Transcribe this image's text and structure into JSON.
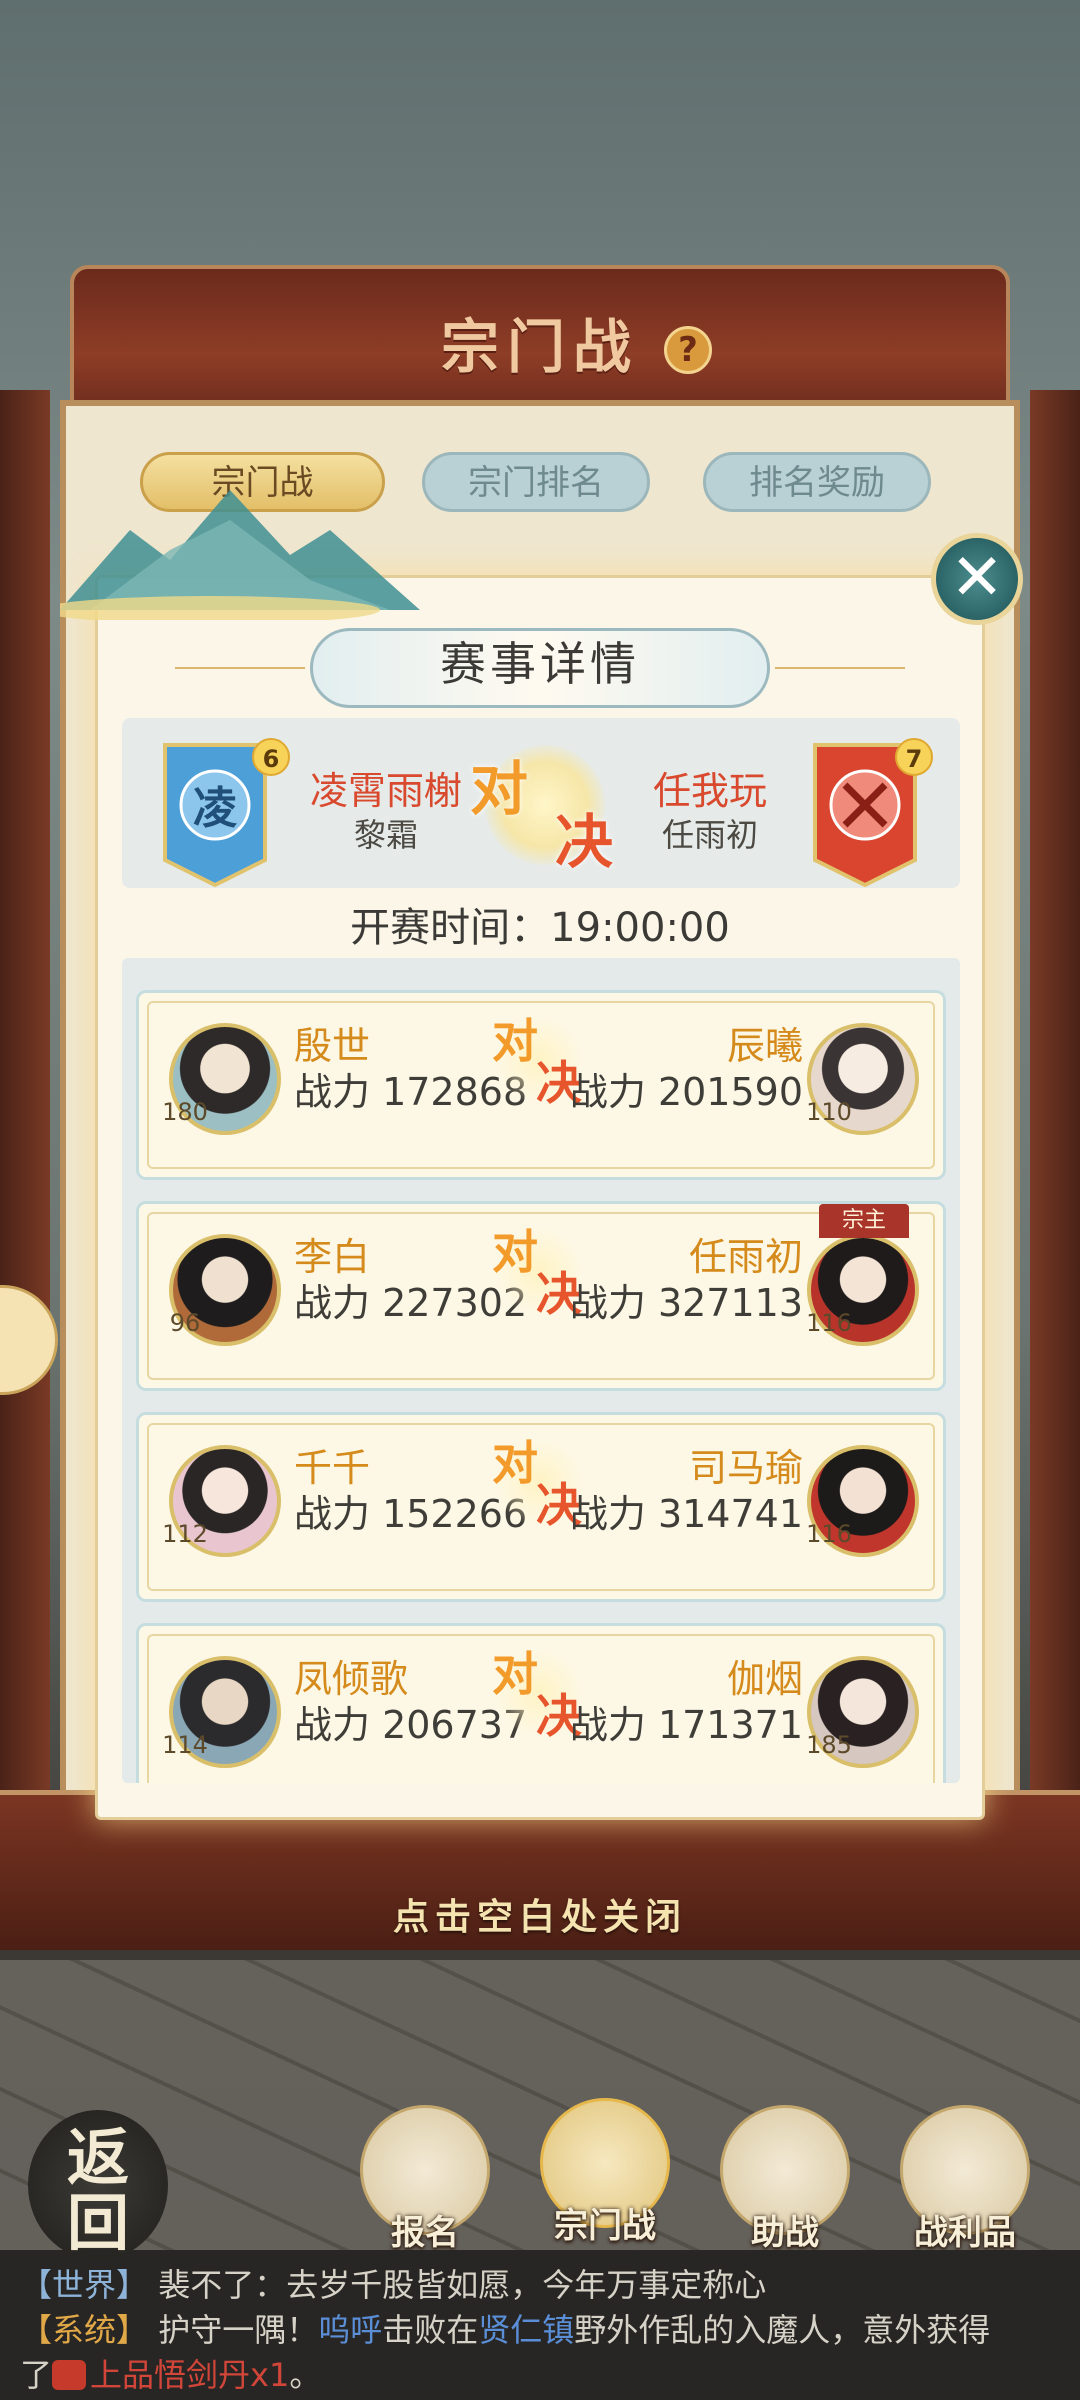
{
  "window": {
    "title": "宗门战"
  },
  "tabs": [
    {
      "label": "宗门战",
      "active": true
    },
    {
      "label": "宗门排名",
      "active": false
    },
    {
      "label": "排名奖励",
      "active": false
    }
  ],
  "dialog": {
    "title": "赛事详情",
    "close_icon": "close-icon",
    "match": {
      "left": {
        "badge": "6",
        "banner_char": "凌",
        "sect": "凌霄雨榭",
        "leader": "黎霜",
        "color": "#4d9fd8"
      },
      "right": {
        "badge": "7",
        "sect": "任我玩",
        "leader": "任雨初",
        "color": "#d9452e"
      },
      "vs_top": "对",
      "vs_bottom": "决"
    },
    "start_time_label": "开赛时间：19:00:00",
    "duels": [
      {
        "left_name": "殷世",
        "left_power": "战力 172868",
        "left_level": "180",
        "right_name": "辰曦",
        "right_power": "战力 201590",
        "right_level": "110",
        "right_tag": ""
      },
      {
        "left_name": "李白",
        "left_power": "战力 227302",
        "left_level": "96",
        "right_name": "任雨初",
        "right_power": "战力 327113",
        "right_level": "116",
        "right_tag": "宗主"
      },
      {
        "left_name": "千千",
        "left_power": "战力 152266",
        "left_level": "112",
        "right_name": "司马瑜",
        "right_power": "战力 314741",
        "right_level": "116",
        "right_tag": ""
      },
      {
        "left_name": "凤倾歌",
        "left_power": "战力 206737",
        "left_level": "114",
        "right_name": "伽烟",
        "right_power": "战力 171371",
        "right_level": "185",
        "right_tag": ""
      }
    ]
  },
  "close_hint": "点击空白处关闭",
  "back_label": "返回",
  "nav": [
    {
      "label": "报名",
      "icon": "scroll-icon"
    },
    {
      "label": "宗门战",
      "icon": "flag-mountain-icon"
    },
    {
      "label": "助战",
      "icon": "handshake-icon"
    },
    {
      "label": "战利品",
      "icon": "treasure-chest-icon"
    }
  ],
  "chat": {
    "line1_tag": "【世界】",
    "line1_text": "裴不了：去岁千股皆如愿，今年万事定称心",
    "line2_tag": "【系统】",
    "line2_a": "护守一隅！",
    "line2_b": "呜呼",
    "line2_c": "击败在",
    "line2_d": "贤仁镇",
    "line2_e": "野外作乱的入魔人，意外获得",
    "line3_a": "了",
    "line3_b": "上品悟剑丹x1",
    "line3_c": "。"
  }
}
